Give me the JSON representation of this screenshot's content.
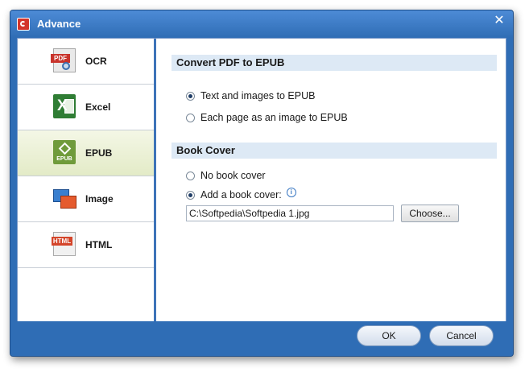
{
  "window": {
    "title": "Advance",
    "close_glyph": "✕"
  },
  "nav": {
    "items": [
      {
        "label": "OCR",
        "icon": "pdf-ocr-icon",
        "icon_text": "PDF"
      },
      {
        "label": "Excel",
        "icon": "excel-icon",
        "icon_text": "X"
      },
      {
        "label": "EPUB",
        "icon": "epub-icon",
        "icon_text": "EPUB",
        "active": true
      },
      {
        "label": "Image",
        "icon": "image-icon"
      },
      {
        "label": "HTML",
        "icon": "html-icon",
        "icon_text": "HTML"
      }
    ]
  },
  "convert": {
    "header": "Convert PDF to EPUB",
    "option_text_images": "Text and images to EPUB",
    "option_page_image": "Each page as an image to EPUB",
    "selected": "text_images"
  },
  "cover": {
    "header": "Book Cover",
    "option_none": "No book cover",
    "option_add": "Add a book cover:",
    "selected": "add",
    "path_value": "C:\\Softpedia\\Softpedia 1.jpg",
    "choose_label": "Choose...",
    "info_glyph": "i"
  },
  "footer": {
    "ok_label": "OK",
    "cancel_label": "Cancel"
  },
  "colors": {
    "frame": "#2f6db5",
    "section_header": "#dde9f5",
    "active_nav": "#e3ebc7"
  }
}
